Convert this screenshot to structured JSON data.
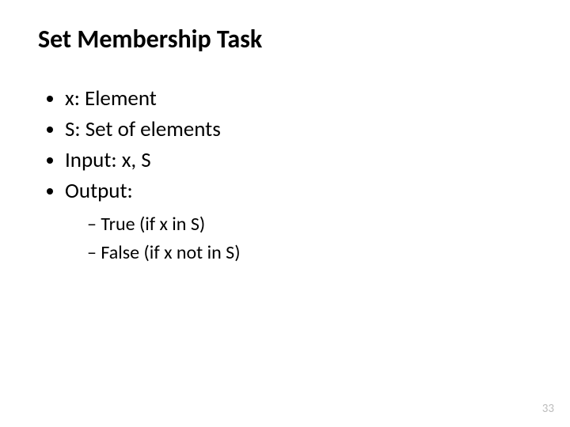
{
  "title": "Set Membership Task",
  "bullets": {
    "b0": "x: Element",
    "b1": "S: Set of elements",
    "b2": "Input: x, S",
    "b3": "Output:",
    "sub0": "True (if x in S)",
    "sub1": "False (if x not in S)"
  },
  "page_number": "33"
}
